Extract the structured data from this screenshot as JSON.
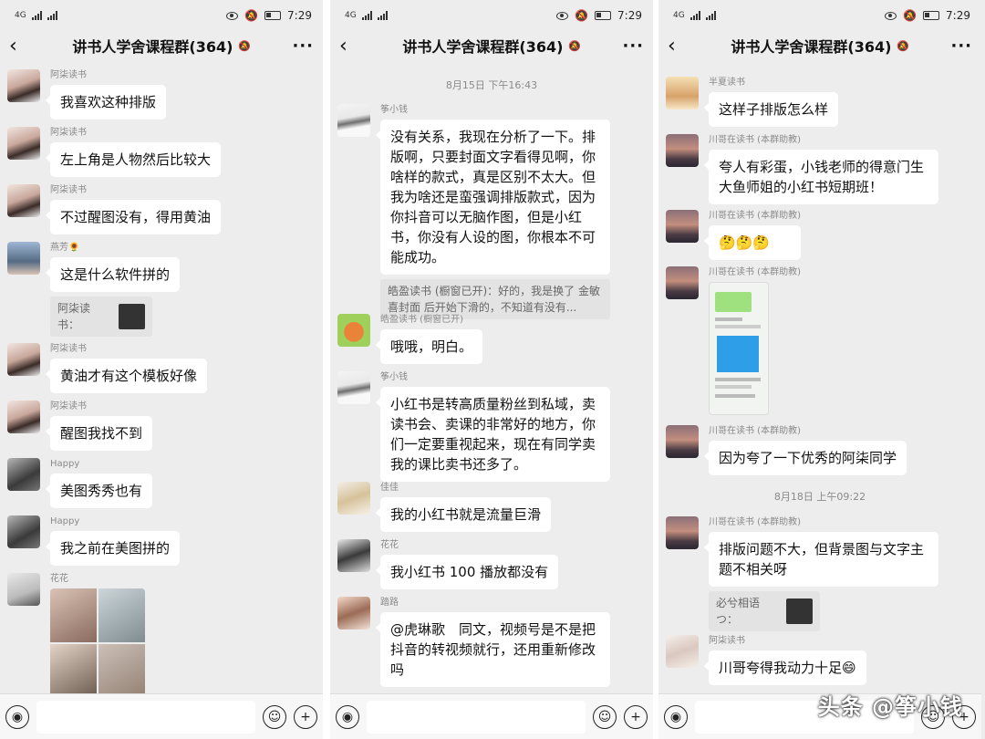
{
  "status": {
    "net": "4G",
    "time": "7:29"
  },
  "group_title": "讲书人学舍课程群(364)",
  "watermark": "头条 @筝小钱",
  "panel1": {
    "messages": [
      {
        "nick": "阿柒读书",
        "text": "我喜欢这种排版"
      },
      {
        "nick": "阿柒读书",
        "text": "左上角是人物然后比较大"
      },
      {
        "nick": "阿柒读书",
        "text": "不过醒图没有，得用黄油"
      },
      {
        "nick": "燕芳🌻",
        "text": "这是什么软件拼的",
        "quote": "阿柒读书："
      },
      {
        "nick": "阿柒读书",
        "text": "黄油才有这个模板好像"
      },
      {
        "nick": "阿柒读书",
        "text": "醒图我找不到"
      },
      {
        "nick": "Happy",
        "text": "美图秀秀也有"
      },
      {
        "nick": "Happy",
        "text": "我之前在美图拼的"
      },
      {
        "nick": "花花",
        "text": ""
      }
    ]
  },
  "panel2": {
    "time_sep": "8月15日 下午16:43",
    "messages": [
      {
        "nick": "筝小钱",
        "text": "没有关系，我现在分析了一下。排版啊，只要封面文字看得见啊，你啥样的款式，真是区别不太大。但我为啥还是蛮强调排版款式，因为你抖音可以无脑作图，但是小红书，你没有人设的图，你根本不可能成功。",
        "quote": "皓盈读书 (橱窗已开)：好的，我是换了 金敏喜封面 后开始下滑的，不知道有没有..."
      },
      {
        "nick": "皓盈读书 (橱窗已开)",
        "text": "哦哦，明白。"
      },
      {
        "nick": "筝小钱",
        "text": "小红书是转高质量粉丝到私域，卖读书会、卖课的非常好的地方，你们一定要重视起来，现在有同学卖我的课比卖书还多了。"
      },
      {
        "nick": "佳佳",
        "text": "我的小红书就是流量巨滑"
      },
      {
        "nick": "花花",
        "text": "我小红书 100 播放都没有"
      },
      {
        "nick": "踏路",
        "text": "@虎琳歌　同文，视频号是不是把抖音的转视频就行，还用重新修改吗"
      }
    ]
  },
  "panel3": {
    "time_sep": "8月18日 上午09:22",
    "messages": [
      {
        "nick": "半夏读书",
        "text": "这样子排版怎么样"
      },
      {
        "nick": "川哥在读书 (本群助教)",
        "text": "夸人有彩蛋，小钱老师的得意门生大鱼师姐的小红书短期班！"
      },
      {
        "nick": "川哥在读书 (本群助教)",
        "text": "🤔🤔🤔"
      },
      {
        "nick": "川哥在读书 (本群助教)",
        "text": ""
      },
      {
        "nick": "川哥在读书 (本群助教)",
        "text": "因为夸了一下优秀的阿柒同学"
      },
      {
        "nick": "川哥在读书 (本群助教)",
        "text": "排版问题不大，但背景图与文字主题不相关呀",
        "quote": "必兮相语つ："
      },
      {
        "nick": "阿柒读书",
        "text": "川哥夸得我动力十足😄"
      }
    ]
  },
  "icons": {
    "back": "back-arrow-icon",
    "more": "more-icon",
    "voice": "voice-icon",
    "emoji": "emoji-icon",
    "add": "add-icon"
  }
}
